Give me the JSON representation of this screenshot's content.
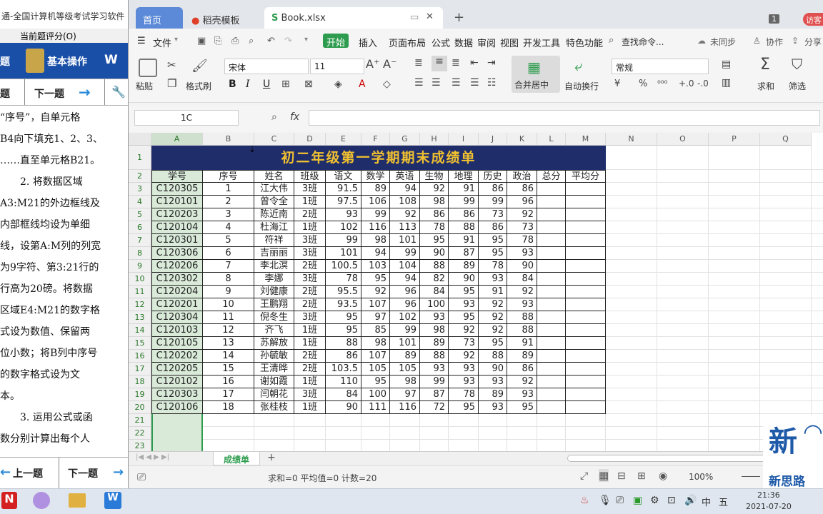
{
  "left_panel": {
    "title": "通-全国计算机等级考试学习软件",
    "score_label": "当前题评分(O)",
    "toolbar1_a": "题",
    "toolbar1_b": "基本操作",
    "toolbar1_c": "W",
    "toolbar2_a": "题",
    "toolbar2_b": "下一题",
    "lines": [
      "“序号”，自单元格",
      "B4向下填充1、2、3、",
      "……直至单元格B21。",
      "　　2. 将数据区域",
      "A3:M21的外边框线及",
      "内部框线均设为单细",
      "线，设第A:M列的列宽",
      "为9字符、第3:21行的",
      "行高为20磅。将数据",
      "区域E4:M21的数字格",
      "式设为数值、保留两",
      "位小数；将B列中序号",
      "的数字格式设为文",
      "本。",
      "　　3. 运用公式或函",
      "数分别计算出每个人"
    ],
    "prev_label": "上一题",
    "next_label": "下一题"
  },
  "tabs": {
    "home": "首页",
    "template": "稻壳模板",
    "book": "Book.xlsx",
    "badge": "1",
    "visitor": "访客"
  },
  "menu": {
    "file": "文件",
    "start": "开始",
    "items": [
      "插入",
      "页面布局",
      "公式",
      "数据",
      "审阅",
      "视图",
      "开发工具",
      "特色功能"
    ],
    "search": "查找命令...",
    "sync": "未同步",
    "collab": "协作",
    "share": "分享"
  },
  "ribbon": {
    "paste": "粘贴",
    "format_painter": "格式刷",
    "font": "宋体",
    "size": "11",
    "merge": "合并居中",
    "wrap": "自动换行",
    "numfmt": "常规",
    "sum": "求和",
    "filter": "筛选"
  },
  "formula_bar": {
    "cellref": "1C",
    "fx": "fx",
    "value": ""
  },
  "columns": [
    "A",
    "B",
    "C",
    "D",
    "E",
    "F",
    "G",
    "H",
    "I",
    "J",
    "K",
    "L",
    "M",
    "N",
    "O",
    "P",
    "Q"
  ],
  "rows": [
    "1",
    "2",
    "3",
    "4",
    "5",
    "6",
    "7",
    "8",
    "9",
    "10",
    "11",
    "12",
    "13",
    "14",
    "15",
    "16",
    "17",
    "18",
    "19",
    "20",
    "21",
    "22",
    "23",
    "24"
  ],
  "sheet": {
    "title": "初二年级第一学期期末成绩单",
    "headers": [
      "学号",
      "序号",
      "姓名",
      "班级",
      "语文",
      "数学",
      "英语",
      "生物",
      "地理",
      "历史",
      "政治",
      "总分",
      "平均分"
    ],
    "data": [
      [
        "C120305",
        "1",
        "江大伟",
        "3班",
        "91.5",
        "89",
        "94",
        "92",
        "91",
        "86",
        "86",
        "",
        ""
      ],
      [
        "C120101",
        "2",
        "曾令全",
        "1班",
        "97.5",
        "106",
        "108",
        "98",
        "99",
        "99",
        "96",
        "",
        ""
      ],
      [
        "C120203",
        "3",
        "陈近南",
        "2班",
        "93",
        "99",
        "92",
        "86",
        "86",
        "73",
        "92",
        "",
        ""
      ],
      [
        "C120104",
        "4",
        "杜海江",
        "1班",
        "102",
        "116",
        "113",
        "78",
        "88",
        "86",
        "73",
        "",
        ""
      ],
      [
        "C120301",
        "5",
        "符祥",
        "3班",
        "99",
        "98",
        "101",
        "95",
        "91",
        "95",
        "78",
        "",
        ""
      ],
      [
        "C120306",
        "6",
        "吉丽丽",
        "3班",
        "101",
        "94",
        "99",
        "90",
        "87",
        "95",
        "93",
        "",
        ""
      ],
      [
        "C120206",
        "7",
        "李北溟",
        "2班",
        "100.5",
        "103",
        "104",
        "88",
        "89",
        "78",
        "90",
        "",
        ""
      ],
      [
        "C120302",
        "8",
        "李娜",
        "3班",
        "78",
        "95",
        "94",
        "82",
        "90",
        "93",
        "84",
        "",
        ""
      ],
      [
        "C120204",
        "9",
        "刘健康",
        "2班",
        "95.5",
        "92",
        "96",
        "84",
        "95",
        "91",
        "92",
        "",
        ""
      ],
      [
        "C120201",
        "10",
        "王鹏翔",
        "2班",
        "93.5",
        "107",
        "96",
        "100",
        "93",
        "92",
        "93",
        "",
        ""
      ],
      [
        "C120304",
        "11",
        "倪冬生",
        "3班",
        "95",
        "97",
        "102",
        "93",
        "95",
        "92",
        "88",
        "",
        ""
      ],
      [
        "C120103",
        "12",
        "齐飞",
        "1班",
        "95",
        "85",
        "99",
        "98",
        "92",
        "92",
        "88",
        "",
        ""
      ],
      [
        "C120105",
        "13",
        "苏解放",
        "1班",
        "88",
        "98",
        "101",
        "89",
        "73",
        "95",
        "91",
        "",
        ""
      ],
      [
        "C120202",
        "14",
        "孙毓敏",
        "2班",
        "86",
        "107",
        "89",
        "88",
        "92",
        "88",
        "89",
        "",
        ""
      ],
      [
        "C120205",
        "15",
        "王清晔",
        "2班",
        "103.5",
        "105",
        "105",
        "93",
        "93",
        "90",
        "86",
        "",
        ""
      ],
      [
        "C120102",
        "16",
        "谢如霞",
        "1班",
        "110",
        "95",
        "98",
        "99",
        "93",
        "93",
        "92",
        "",
        ""
      ],
      [
        "C120303",
        "17",
        "闫朝花",
        "3班",
        "84",
        "100",
        "97",
        "87",
        "78",
        "89",
        "93",
        "",
        ""
      ],
      [
        "C120106",
        "18",
        "张桂枝",
        "1班",
        "90",
        "111",
        "116",
        "72",
        "95",
        "93",
        "95",
        "",
        ""
      ]
    ]
  },
  "sheet_tab": "成绩单",
  "status": {
    "summary": "求和=0  平均值=0  计数=20",
    "zoom": "100%"
  },
  "watermark": "新思路",
  "clock": {
    "time": "21:36",
    "date": "2021-07-20"
  },
  "colors": {
    "title_bg": "#1f2d6b",
    "title_fg": "#f0c030",
    "accent": "#2e9c4e",
    "selected_col": "#d9ead9"
  }
}
